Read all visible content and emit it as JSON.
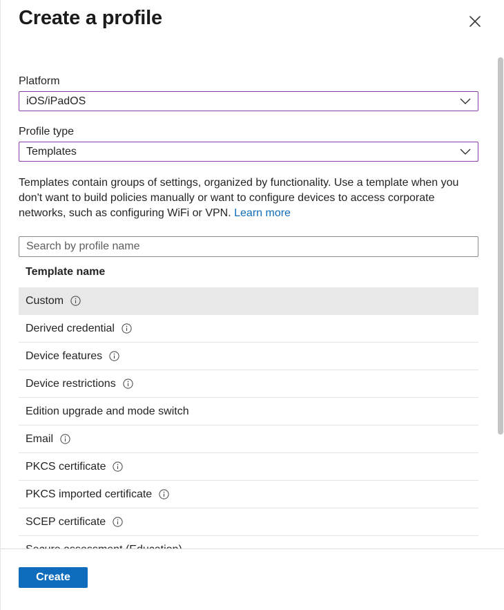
{
  "header": {
    "title": "Create a profile",
    "close_icon": "close-icon"
  },
  "form": {
    "platform": {
      "label": "Platform",
      "value": "iOS/iPadOS"
    },
    "profile_type": {
      "label": "Profile type",
      "value": "Templates"
    },
    "description": "Templates contain groups of settings, organized by functionality. Use a template when you don't want to build policies manually or want to configure devices to access corporate networks, such as configuring WiFi or VPN.",
    "learn_more": "Learn more"
  },
  "search": {
    "placeholder": "Search by profile name",
    "value": ""
  },
  "table": {
    "column_header": "Template name",
    "rows": [
      {
        "name": "Custom",
        "info": true,
        "selected": true
      },
      {
        "name": "Derived credential",
        "info": true
      },
      {
        "name": "Device features",
        "info": true
      },
      {
        "name": "Device restrictions",
        "info": true
      },
      {
        "name": "Edition upgrade and mode switch",
        "info": false
      },
      {
        "name": "Email",
        "info": true
      },
      {
        "name": "PKCS certificate",
        "info": true
      },
      {
        "name": "PKCS imported certificate",
        "info": true
      },
      {
        "name": "SCEP certificate",
        "info": true
      },
      {
        "name": "Secure assessment (Education)",
        "info": false
      }
    ]
  },
  "footer": {
    "create_label": "Create"
  },
  "colors": {
    "accent": "#0f6cbd",
    "select_border": "#8a3ea8",
    "selected_row": "#e8e8e8"
  }
}
